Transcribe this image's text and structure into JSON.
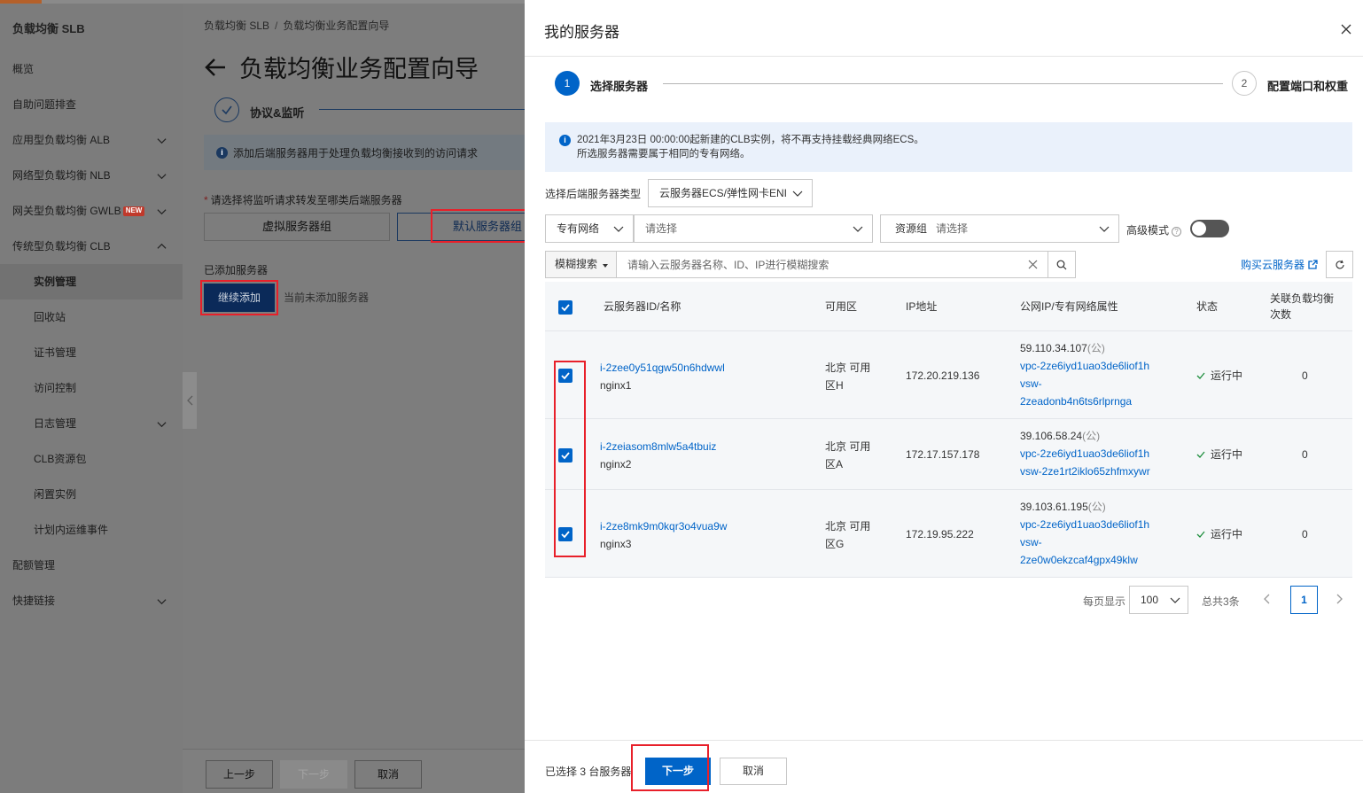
{
  "sidebar": {
    "title": "负载均衡 SLB",
    "items": [
      {
        "label": "概览"
      },
      {
        "label": "自助问题排查"
      },
      {
        "label": "应用型负载均衡 ALB"
      },
      {
        "label": "网络型负载均衡 NLB"
      },
      {
        "label": "网关型负载均衡 GWLB",
        "badge": "NEW"
      },
      {
        "label": "传统型负载均衡 CLB"
      },
      {
        "label": "实例管理"
      },
      {
        "label": "回收站"
      },
      {
        "label": "证书管理"
      },
      {
        "label": "访问控制"
      },
      {
        "label": "日志管理"
      },
      {
        "label": "CLB资源包"
      },
      {
        "label": "闲置实例"
      },
      {
        "label": "计划内运维事件"
      },
      {
        "label": "配额管理"
      },
      {
        "label": "快捷链接"
      }
    ]
  },
  "background_page": {
    "breadcrumb": [
      "负载均衡 SLB",
      "负载均衡业务配置向导"
    ],
    "breadcrumb_sep": "/",
    "title": "负载均衡业务配置向导",
    "step1_label": "协议&监听",
    "info_text": "添加后端服务器用于处理负载均衡接收到的访问请求",
    "required_label": "请选择将监听请求转发至哪类后端服务器",
    "required_star": "*",
    "tab_virtual": "虚拟服务器组",
    "tab_default": "默认服务器组",
    "added_label": "已添加服务器",
    "continue_btn": "继续添加",
    "none_added": "当前未添加服务器",
    "footer": {
      "prev": "上一步",
      "next": "下一步",
      "cancel": "取消"
    }
  },
  "drawer": {
    "title": "我的服务器",
    "steps": [
      {
        "num": "1",
        "label": "选择服务器"
      },
      {
        "num": "2",
        "label": "配置端口和权重"
      }
    ],
    "notice_line1": "2021年3月23日 00:00:00起新建的CLB实例，将不再支持挂载经典网络ECS。",
    "notice_line2": "所选服务器需要属于相同的专有网络。",
    "type_label": "选择后端服务器类型",
    "type_value": "云服务器ECS/弹性网卡ENI",
    "vpc_select": "专有网络",
    "vpc_placeholder": "请选择",
    "resource_group_label": "资源组",
    "resource_group_placeholder": "请选择",
    "advanced_mode": "高级模式",
    "advanced_help": "?",
    "search_mode": "模糊搜索",
    "search_placeholder": "请输入云服务器名称、ID、IP进行模糊搜索",
    "buy_link": "购买云服务器",
    "table": {
      "headers": {
        "id_name": "云服务器ID/名称",
        "zone": "可用区",
        "ip": "IP地址",
        "public_ip": "公网IP/专有网络属性",
        "status": "状态",
        "lb_count_1": "关联负载均衡",
        "lb_count_2": "次数"
      },
      "rows": [
        {
          "id": "i-2zee0y51qgw50n6hdwwl",
          "name": "nginx1",
          "zone_1": "北京 可用",
          "zone_2": "区H",
          "ip": "172.20.219.136",
          "public_ip": "59.110.34.107",
          "public_tag": "(公)",
          "vpc": "vpc-2ze6iyd1uao3de6liof1h",
          "vsw_1": "vsw-",
          "vsw_2": "2zeadonb4n6ts6rlprnga",
          "status": "运行中",
          "lb_count": "0"
        },
        {
          "id": "i-2zeiasom8mlw5a4tbuiz",
          "name": "nginx2",
          "zone_1": "北京 可用",
          "zone_2": "区A",
          "ip": "172.17.157.178",
          "public_ip": "39.106.58.24",
          "public_tag": "(公)",
          "vpc": "vpc-2ze6iyd1uao3de6liof1h",
          "vsw_1": "vsw-2ze1rt2iklo65zhfmxywr",
          "vsw_2": "",
          "status": "运行中",
          "lb_count": "0"
        },
        {
          "id": "i-2ze8mk9m0kqr3o4vua9w",
          "name": "nginx3",
          "zone_1": "北京 可用",
          "zone_2": "区G",
          "ip": "172.19.95.222",
          "public_ip": "39.103.61.195",
          "public_tag": "(公)",
          "vpc": "vpc-2ze6iyd1uao3de6liof1h",
          "vsw_1": "vsw-",
          "vsw_2": "2ze0w0ekzcaf4gpx49klw",
          "status": "运行中",
          "lb_count": "0"
        }
      ]
    },
    "pagination": {
      "per_page_label": "每页显示",
      "per_page_value": "100",
      "total": "总共3条",
      "current_page": "1"
    },
    "footer": {
      "selected": "已选择 3 台服务器",
      "next": "下一步",
      "cancel": "取消"
    }
  },
  "colors": {
    "primary": "#0064c8",
    "highlight_box": "#e8202a",
    "notice_bg": "#eaf1fb",
    "table_bg": "#f5f7f9"
  }
}
